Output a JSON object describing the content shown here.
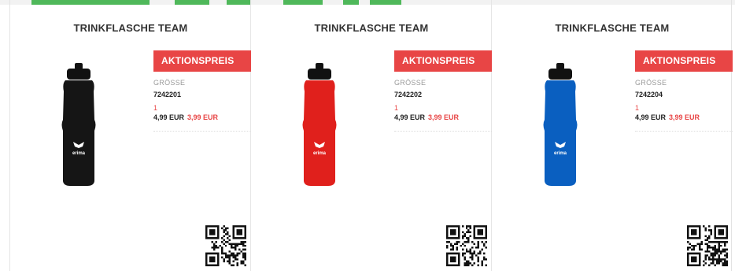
{
  "products": [
    {
      "title": "TRINKFLASCHE TEAM",
      "promo_label": "AKTIONSPREIS",
      "size_label": "GRÖSSE",
      "sku": "7242201",
      "quantity": "1",
      "old_price": "4,99 EUR",
      "new_price": "3,99 EUR",
      "bottle_color": "#151515",
      "brand": "erima"
    },
    {
      "title": "TRINKFLASCHE TEAM",
      "promo_label": "AKTIONSPREIS",
      "size_label": "GRÖSSE",
      "sku": "7242202",
      "quantity": "1",
      "old_price": "4,99 EUR",
      "new_price": "3,99 EUR",
      "bottle_color": "#e0201c",
      "brand": "erima"
    },
    {
      "title": "TRINKFLASCHE TEAM",
      "promo_label": "AKTIONSPREIS",
      "size_label": "GRÖSSE",
      "sku": "7242204",
      "quantity": "1",
      "old_price": "4,99 EUR",
      "new_price": "3,99 EUR",
      "bottle_color": "#0a5fc0",
      "brand": "erima"
    }
  ],
  "colors": {
    "accent": "#e84545",
    "cap": "#111111",
    "banner_green": "#4fb85a"
  }
}
